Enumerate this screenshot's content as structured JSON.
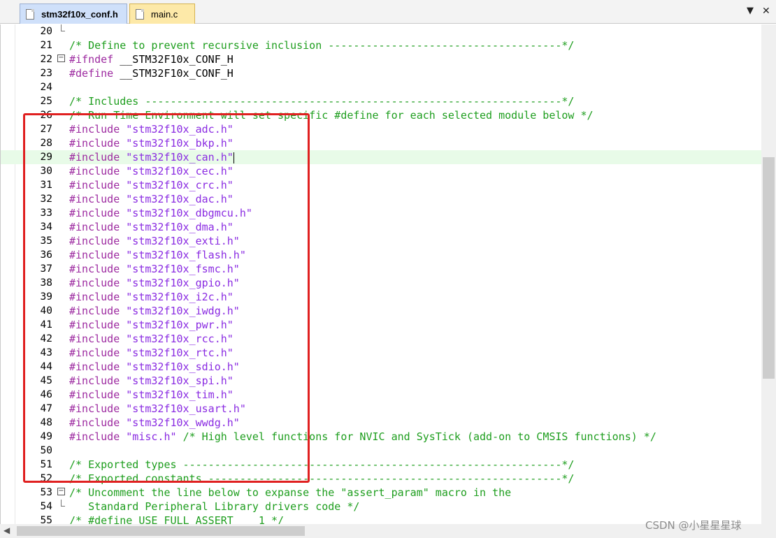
{
  "tabs": [
    {
      "label": "stm32f10x_conf.h",
      "active": true
    },
    {
      "label": "main.c",
      "active": false
    }
  ],
  "tab_controls": {
    "menu_glyph": "▼",
    "close_glyph": "✕"
  },
  "editor": {
    "cursor_line": 29,
    "lines": [
      {
        "n": "20",
        "parts": []
      },
      {
        "n": "21",
        "parts": [
          {
            "c": "cm",
            "t": "/* Define to prevent recursive inclusion -------------------------------------*/"
          }
        ]
      },
      {
        "n": "22",
        "parts": [
          {
            "c": "kw",
            "t": "#ifndef"
          },
          {
            "c": "",
            "t": " __STM32F10x_CONF_H"
          }
        ]
      },
      {
        "n": "23",
        "parts": [
          {
            "c": "kw",
            "t": "#define"
          },
          {
            "c": "",
            "t": " __STM32F10x_CONF_H"
          }
        ]
      },
      {
        "n": "24",
        "parts": []
      },
      {
        "n": "25",
        "parts": [
          {
            "c": "cm",
            "t": "/* Includes ------------------------------------------------------------------*/"
          }
        ]
      },
      {
        "n": "26",
        "parts": [
          {
            "c": "cm",
            "t": "/* Run Time Environment will set specific #define for each selected module below */"
          }
        ]
      },
      {
        "n": "27",
        "parts": [
          {
            "c": "kw",
            "t": "#include"
          },
          {
            "c": "",
            "t": " "
          },
          {
            "c": "str",
            "t": "\"stm32f10x_adc.h\""
          }
        ]
      },
      {
        "n": "28",
        "parts": [
          {
            "c": "kw",
            "t": "#include"
          },
          {
            "c": "",
            "t": " "
          },
          {
            "c": "str",
            "t": "\"stm32f10x_bkp.h\""
          }
        ]
      },
      {
        "n": "29",
        "parts": [
          {
            "c": "kw",
            "t": "#include"
          },
          {
            "c": "",
            "t": " "
          },
          {
            "c": "str",
            "t": "\"stm32f10x_can.h\""
          }
        ]
      },
      {
        "n": "30",
        "parts": [
          {
            "c": "kw",
            "t": "#include"
          },
          {
            "c": "",
            "t": " "
          },
          {
            "c": "str",
            "t": "\"stm32f10x_cec.h\""
          }
        ]
      },
      {
        "n": "31",
        "parts": [
          {
            "c": "kw",
            "t": "#include"
          },
          {
            "c": "",
            "t": " "
          },
          {
            "c": "str",
            "t": "\"stm32f10x_crc.h\""
          }
        ]
      },
      {
        "n": "32",
        "parts": [
          {
            "c": "kw",
            "t": "#include"
          },
          {
            "c": "",
            "t": " "
          },
          {
            "c": "str",
            "t": "\"stm32f10x_dac.h\""
          }
        ]
      },
      {
        "n": "33",
        "parts": [
          {
            "c": "kw",
            "t": "#include"
          },
          {
            "c": "",
            "t": " "
          },
          {
            "c": "str",
            "t": "\"stm32f10x_dbgmcu.h\""
          }
        ]
      },
      {
        "n": "34",
        "parts": [
          {
            "c": "kw",
            "t": "#include"
          },
          {
            "c": "",
            "t": " "
          },
          {
            "c": "str",
            "t": "\"stm32f10x_dma.h\""
          }
        ]
      },
      {
        "n": "35",
        "parts": [
          {
            "c": "kw",
            "t": "#include"
          },
          {
            "c": "",
            "t": " "
          },
          {
            "c": "str",
            "t": "\"stm32f10x_exti.h\""
          }
        ]
      },
      {
        "n": "36",
        "parts": [
          {
            "c": "kw",
            "t": "#include"
          },
          {
            "c": "",
            "t": " "
          },
          {
            "c": "str",
            "t": "\"stm32f10x_flash.h\""
          }
        ]
      },
      {
        "n": "37",
        "parts": [
          {
            "c": "kw",
            "t": "#include"
          },
          {
            "c": "",
            "t": " "
          },
          {
            "c": "str",
            "t": "\"stm32f10x_fsmc.h\""
          }
        ]
      },
      {
        "n": "38",
        "parts": [
          {
            "c": "kw",
            "t": "#include"
          },
          {
            "c": "",
            "t": " "
          },
          {
            "c": "str",
            "t": "\"stm32f10x_gpio.h\""
          }
        ]
      },
      {
        "n": "39",
        "parts": [
          {
            "c": "kw",
            "t": "#include"
          },
          {
            "c": "",
            "t": " "
          },
          {
            "c": "str",
            "t": "\"stm32f10x_i2c.h\""
          }
        ]
      },
      {
        "n": "40",
        "parts": [
          {
            "c": "kw",
            "t": "#include"
          },
          {
            "c": "",
            "t": " "
          },
          {
            "c": "str",
            "t": "\"stm32f10x_iwdg.h\""
          }
        ]
      },
      {
        "n": "41",
        "parts": [
          {
            "c": "kw",
            "t": "#include"
          },
          {
            "c": "",
            "t": " "
          },
          {
            "c": "str",
            "t": "\"stm32f10x_pwr.h\""
          }
        ]
      },
      {
        "n": "42",
        "parts": [
          {
            "c": "kw",
            "t": "#include"
          },
          {
            "c": "",
            "t": " "
          },
          {
            "c": "str",
            "t": "\"stm32f10x_rcc.h\""
          }
        ]
      },
      {
        "n": "43",
        "parts": [
          {
            "c": "kw",
            "t": "#include"
          },
          {
            "c": "",
            "t": " "
          },
          {
            "c": "str",
            "t": "\"stm32f10x_rtc.h\""
          }
        ]
      },
      {
        "n": "44",
        "parts": [
          {
            "c": "kw",
            "t": "#include"
          },
          {
            "c": "",
            "t": " "
          },
          {
            "c": "str",
            "t": "\"stm32f10x_sdio.h\""
          }
        ]
      },
      {
        "n": "45",
        "parts": [
          {
            "c": "kw",
            "t": "#include"
          },
          {
            "c": "",
            "t": " "
          },
          {
            "c": "str",
            "t": "\"stm32f10x_spi.h\""
          }
        ]
      },
      {
        "n": "46",
        "parts": [
          {
            "c": "kw",
            "t": "#include"
          },
          {
            "c": "",
            "t": " "
          },
          {
            "c": "str",
            "t": "\"stm32f10x_tim.h\""
          }
        ]
      },
      {
        "n": "47",
        "parts": [
          {
            "c": "kw",
            "t": "#include"
          },
          {
            "c": "",
            "t": " "
          },
          {
            "c": "str",
            "t": "\"stm32f10x_usart.h\""
          }
        ]
      },
      {
        "n": "48",
        "parts": [
          {
            "c": "kw",
            "t": "#include"
          },
          {
            "c": "",
            "t": " "
          },
          {
            "c": "str",
            "t": "\"stm32f10x_wwdg.h\""
          }
        ]
      },
      {
        "n": "49",
        "parts": [
          {
            "c": "kw",
            "t": "#include"
          },
          {
            "c": "",
            "t": " "
          },
          {
            "c": "str",
            "t": "\"misc.h\""
          },
          {
            "c": "",
            "t": " "
          },
          {
            "c": "cm",
            "t": "/* High level functions for NVIC and SysTick (add-on to CMSIS functions) */"
          }
        ]
      },
      {
        "n": "50",
        "parts": []
      },
      {
        "n": "51",
        "parts": [
          {
            "c": "cm",
            "t": "/* Exported types ------------------------------------------------------------*/"
          }
        ]
      },
      {
        "n": "52",
        "parts": [
          {
            "c": "cm",
            "t": "/* Exported constants --------------------------------------------------------*/"
          }
        ]
      },
      {
        "n": "53",
        "parts": [
          {
            "c": "cm",
            "t": "/* Uncomment the line below to expanse the \"assert_param\" macro in the"
          }
        ]
      },
      {
        "n": "54",
        "parts": [
          {
            "c": "cm",
            "t": "   Standard Peripheral Library drivers code */"
          }
        ]
      },
      {
        "n": "55",
        "parts": [
          {
            "c": "cm",
            "t": "/* #define USE_FULL_ASSERT    1 */"
          }
        ]
      }
    ]
  },
  "watermark": "CSDN @小星星星球",
  "colors": {
    "comment": "#1e9e1e",
    "preprocessor": "#9d2aa0",
    "string": "#8a2be2",
    "highlight_box": "#e02020",
    "active_line": "#e8fbe8"
  }
}
